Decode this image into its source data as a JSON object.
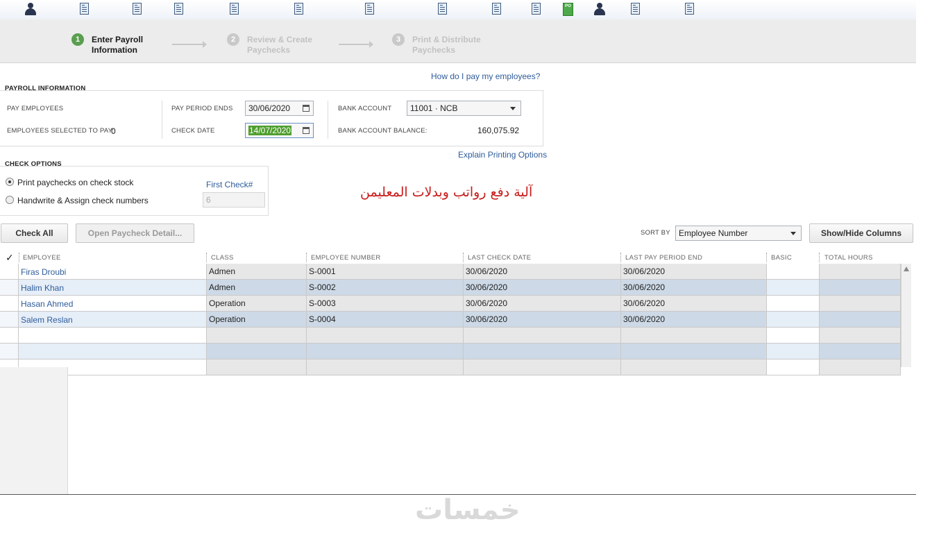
{
  "toolbar_icons": [
    "person-icon",
    "document-icon",
    "document-icon",
    "document-icon",
    "document-icon",
    "document-icon",
    "document-icon",
    "document-icon",
    "document-icon",
    "document-icon",
    "purchase-order-icon",
    "person-icon",
    "documents-icon",
    "document-icon"
  ],
  "steps": [
    {
      "number": "1",
      "line1": "Enter Payroll",
      "line2": "Information",
      "state": "active"
    },
    {
      "number": "2",
      "line1": "Review & Create",
      "line2": "Paychecks",
      "state": "inactive"
    },
    {
      "number": "3",
      "line1": "Print & Distribute",
      "line2": "Paychecks",
      "state": "inactive"
    }
  ],
  "help_link": "How do I pay my employees?",
  "payroll_info": {
    "section_title": "PAYROLL INFORMATION",
    "pay_employees_label": "PAY EMPLOYEES",
    "selected_label": "EMPLOYEES SELECTED TO PAY:",
    "selected_count": "0",
    "pay_period_ends_label": "PAY PERIOD ENDS",
    "pay_period_ends_value": "30/06/2020",
    "check_date_label": "CHECK DATE",
    "check_date_value": "14/07/2020",
    "bank_account_label": "BANK ACCOUNT",
    "bank_account_value": "11001 · NCB",
    "bank_balance_label": "BANK ACCOUNT BALANCE:",
    "bank_balance_value": "160,075.92"
  },
  "explain_link": "Explain Printing Options",
  "check_options": {
    "section_title": "CHECK OPTIONS",
    "option_print": "Print paychecks on check stock",
    "option_handwrite": "Handwrite & Assign check numbers",
    "selected_option": "print",
    "first_check_label": "First Check#",
    "first_check_value": "6"
  },
  "annotation_arabic": "آلية دفع رواتب وبدلات المعليمن",
  "buttons": {
    "check_all": "Check All",
    "open_detail": "Open Paycheck Detail...",
    "show_hide": "Show/Hide Columns"
  },
  "sort": {
    "label": "SORT BY",
    "value": "Employee Number"
  },
  "table": {
    "check_header": "✓",
    "columns": [
      "EMPLOYEE",
      "CLASS",
      "EMPLOYEE NUMBER",
      "LAST CHECK DATE",
      "LAST PAY PERIOD END",
      "BASIC",
      "TOTAL HOURS"
    ],
    "rows": [
      {
        "employee": "Firas Droubi",
        "class": "Admen",
        "number": "S-0001",
        "last_check": "30/06/2020",
        "last_period": "30/06/2020",
        "basic": "",
        "hours": ""
      },
      {
        "employee": "Halim Khan",
        "class": "Admen",
        "number": "S-0002",
        "last_check": "30/06/2020",
        "last_period": "30/06/2020",
        "basic": "",
        "hours": ""
      },
      {
        "employee": "Hasan Ahmed",
        "class": "Operation",
        "number": "S-0003",
        "last_check": "30/06/2020",
        "last_period": "30/06/2020",
        "basic": "",
        "hours": ""
      },
      {
        "employee": "Salem Reslan",
        "class": "Operation",
        "number": "S-0004",
        "last_check": "30/06/2020",
        "last_period": "30/06/2020",
        "basic": "",
        "hours": ""
      },
      {
        "employee": "",
        "class": "",
        "number": "",
        "last_check": "",
        "last_period": "",
        "basic": "",
        "hours": ""
      },
      {
        "employee": "",
        "class": "",
        "number": "",
        "last_check": "",
        "last_period": "",
        "basic": "",
        "hours": ""
      },
      {
        "employee": "",
        "class": "",
        "number": "",
        "last_check": "",
        "last_period": "",
        "basic": "",
        "hours": ""
      }
    ]
  },
  "watermark": "خمسات",
  "colors": {
    "accent_link": "#2e5c9a",
    "step_active": "#5a9e50",
    "date_highlight": "#4f9e2e",
    "annotation": "#c81a1a"
  }
}
